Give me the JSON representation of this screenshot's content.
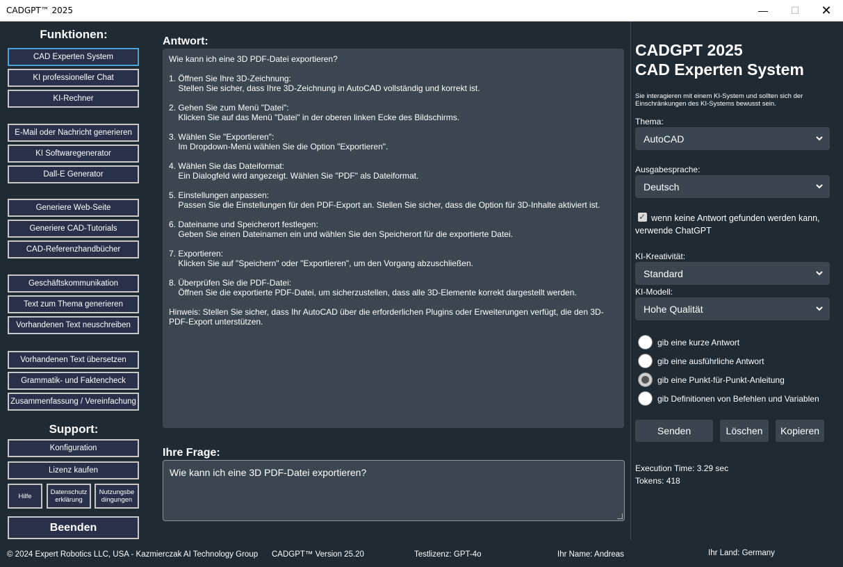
{
  "window": {
    "title": "CADGPT™ 2025",
    "min_glyph": "—",
    "max_glyph": "☐",
    "close_glyph": "✕"
  },
  "sidebar": {
    "functions_title": "Funktionen:",
    "buttons": [
      "CAD Experten System",
      "KI professioneller Chat",
      "KI-Rechner",
      "E-Mail oder Nachricht generieren",
      "KI Softwaregenerator",
      "Dall-E Generator",
      "Generiere Web-Seite",
      "Generiere CAD-Tutorials",
      "CAD-Referenzhandbücher",
      "Geschäftskommunikation",
      "Text zum Thema generieren",
      "Vorhandenen Text neuschreiben",
      "Vorhandenen Text übersetzen",
      "Grammatik- und Faktencheck",
      "Zusammenfassung / Vereinfachung"
    ],
    "support_title": "Support:",
    "support_buttons": [
      "Konfiguration",
      "Lizenz kaufen"
    ],
    "small_buttons": [
      "Hilfe",
      "Datenschutz erklärung",
      "Nutzungsbe dingungen"
    ],
    "exit_label": "Beenden"
  },
  "main": {
    "answer_label": "Antwort:",
    "answer_text": "Wie kann ich eine 3D PDF-Datei exportieren?\n\n1. Öffnen Sie Ihre 3D-Zeichnung:\n    Stellen Sie sicher, dass Ihre 3D-Zeichnung in AutoCAD vollständig und korrekt ist.\n\n2. Gehen Sie zum Menü \"Datei\":\n    Klicken Sie auf das Menü \"Datei\" in der oberen linken Ecke des Bildschirms.\n\n3. Wählen Sie \"Exportieren\":\n    Im Dropdown-Menü wählen Sie die Option \"Exportieren\".\n\n4. Wählen Sie das Dateiformat:\n    Ein Dialogfeld wird angezeigt. Wählen Sie \"PDF\" als Dateiformat.\n\n5. Einstellungen anpassen:\n    Passen Sie die Einstellungen für den PDF-Export an. Stellen Sie sicher, dass die Option für 3D-Inhalte aktiviert ist.\n\n6. Dateiname und Speicherort festlegen:\n    Geben Sie einen Dateinamen ein und wählen Sie den Speicherort für die exportierte Datei.\n\n7. Exportieren:\n    Klicken Sie auf \"Speichern\" oder \"Exportieren\", um den Vorgang abzuschließen.\n\n8. Überprüfen Sie die PDF-Datei:\n    Öffnen Sie die exportierte PDF-Datei, um sicherzustellen, dass alle 3D-Elemente korrekt dargestellt werden.\n\nHinweis: Stellen Sie sicher, dass Ihr AutoCAD über die erforderlichen Plugins oder Erweiterungen verfügt, die den 3D-\nPDF-Export unterstützen.",
    "question_label": "Ihre Frage:",
    "question_text": "Wie kann ich eine 3D PDF-Datei exportieren?"
  },
  "panel": {
    "title_line1": "CADGPT 2025",
    "title_line2": "CAD Experten System",
    "note": "Sie interagieren mit einem KI-System und sollten sich der Einschränkungen des KI-Systems bewusst sein.",
    "theme_label": "Thema:",
    "theme_value": "AutoCAD",
    "language_label": "Ausgabesprache:",
    "language_value": "Deutsch",
    "fallback_checkbox": "wenn keine Antwort gefunden werden kann, verwende ChatGPT",
    "creativity_label": "KI-Kreativität:",
    "creativity_value": "Standard",
    "model_label": "KI-Modell:",
    "model_value": "Hohe Qualität",
    "radio_options": [
      "gib eine kurze Antwort",
      "gib eine ausführliche Antwort",
      "gib eine Punkt-für-Punkt-Anleitung",
      "gib Definitionen von Befehlen und Variablen"
    ],
    "radio_selected_index": 2,
    "send_label": "Senden",
    "clear_label": "Löschen",
    "copy_label": "Kopieren",
    "execution_time": "Execution Time: 3.29 sec",
    "tokens": "Tokens: 418"
  },
  "footer": {
    "copyright": "© 2024 Expert Robotics LLC, USA - Kazmierczak AI Technology Group",
    "version": "CADGPT™ Version 25.20",
    "license": "Testlizenz: GPT-4o",
    "name": "Ihr Name: Andreas",
    "country": "Ihr Land: Germany"
  },
  "colors": {
    "background": "#1f2a33",
    "button_bg": "#2a2f4a",
    "field_bg": "#3b4650",
    "active_border": "#4aa3df"
  }
}
